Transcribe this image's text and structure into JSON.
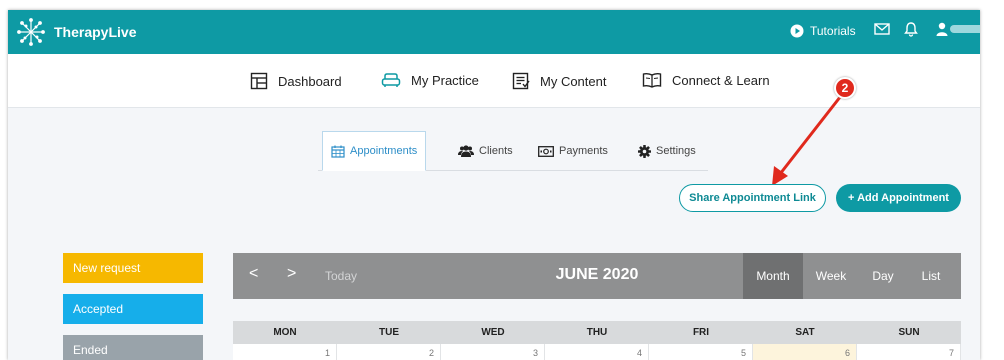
{
  "header": {
    "brand": "TherapyLive",
    "tutorials_label": "Tutorials"
  },
  "main_nav": [
    {
      "label": "Dashboard",
      "icon": "dashboard-icon"
    },
    {
      "label": "My Practice",
      "icon": "sofa-icon"
    },
    {
      "label": "My Content",
      "icon": "content-icon"
    },
    {
      "label": "Connect & Learn",
      "icon": "book-icon"
    }
  ],
  "sub_tabs": [
    {
      "label": "Appointments",
      "icon": "calendar-icon",
      "active": true
    },
    {
      "label": "Clients",
      "icon": "users-icon"
    },
    {
      "label": "Payments",
      "icon": "money-icon"
    },
    {
      "label": "Settings",
      "icon": "gear-icon"
    }
  ],
  "actions": {
    "share_label": "Share Appointment Link",
    "add_label": "+ Add Appointment"
  },
  "annotation": {
    "badge": "2"
  },
  "legend": [
    {
      "label": "New request",
      "color": "#f6b800"
    },
    {
      "label": "Accepted",
      "color": "#16aeea"
    },
    {
      "label": "Ended",
      "color": "#99a3aa"
    }
  ],
  "calendar": {
    "prev": "<",
    "next": ">",
    "today": "Today",
    "title": "JUNE 2020",
    "views": [
      "Month",
      "Week",
      "Day",
      "List"
    ],
    "active_view": "Month",
    "weekdays": [
      "MON",
      "TUE",
      "WED",
      "THU",
      "FRI",
      "SAT",
      "SUN"
    ],
    "first_row": [
      "1",
      "2",
      "3",
      "4",
      "5",
      "6",
      "7"
    ]
  },
  "colors": {
    "brand": "#0e9aa4",
    "active_tab": "#2d8ec8",
    "arrow": "#e0291d"
  }
}
